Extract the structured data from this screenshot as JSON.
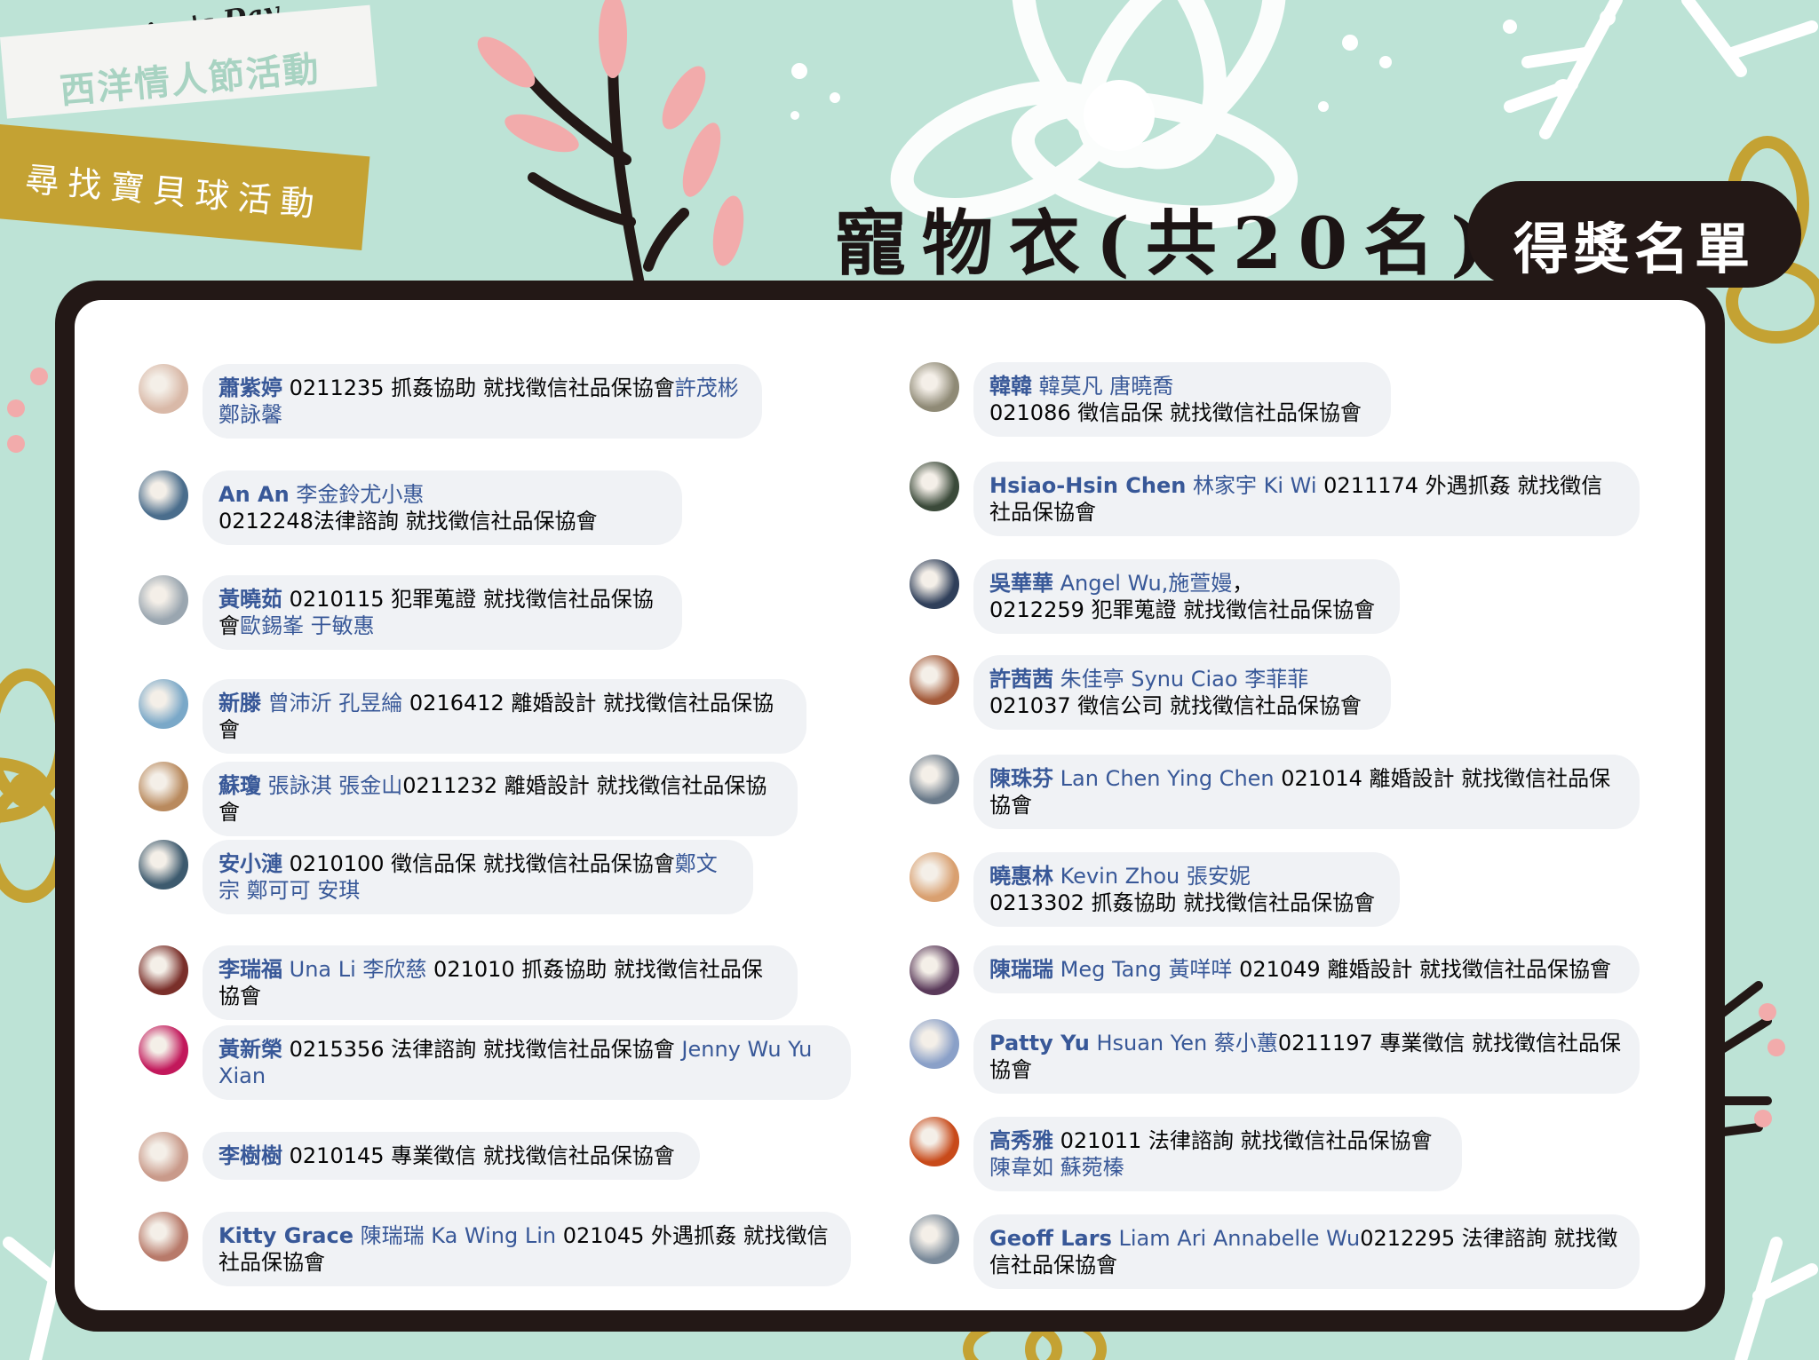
{
  "header": {
    "event_script": "Valentine's Day",
    "event_name": "西洋情人節活動",
    "activity": "尋找寶貝球活動",
    "prize_title": "寵物衣(共20名)",
    "badge": "得獎名單"
  },
  "colors": {
    "background": "#bde3d6",
    "frame": "#231816",
    "gold": "#c4a233",
    "pink": "#f2abab",
    "name_link": "#385898",
    "bubble": "#f0f2f5"
  },
  "left_column": [
    {
      "n1": "蕭紫婷",
      "t1": " 0211235 抓姦協助 就找徵信社品保協會",
      "n2": "許茂彬 鄭詠馨",
      "t2": "",
      "n3": "",
      "t3": "",
      "avatar": "#d9b9a8"
    },
    {
      "n1": "An An",
      "t1": " ",
      "n2": "李金鈴尤小惠",
      "t2": "",
      "n3": "",
      "t3": "0212248法律諮詢 就找徵信社品保協會",
      "avatar": "#4a6d8c"
    },
    {
      "n1": "黃曉茹",
      "t1": " 0210115 犯罪蒐證 就找徵信社品保協會",
      "n2": "歐錫峯 于敏惠",
      "t2": "",
      "n3": "",
      "t3": "",
      "avatar": "#9aa6b0"
    },
    {
      "n1": "新滕",
      "t1": " ",
      "n2": "曾沛沂 孔昱綸",
      "t2": " 0216412 離婚設計 就找徵信社品保協會",
      "n3": "",
      "t3": "",
      "avatar": "#7aa8c8"
    },
    {
      "n1": "蘇瓊",
      "t1": " ",
      "n2": "張詠淇 張金山",
      "t2": "0211232 離婚設計 就找徵信社品保協會",
      "n3": "",
      "t3": "",
      "avatar": "#b98a5e"
    },
    {
      "n1": "安小漣",
      "t1": " 0210100 徵信品保 就找徵信社品保協會",
      "n2": "鄭文宗 鄭可可 安琪",
      "t2": "",
      "n3": "",
      "t3": "",
      "avatar": "#3d5a6e"
    },
    {
      "n1": "李瑞福",
      "t1": " ",
      "n2": "Una Li 李欣慈",
      "t2": " 021010 抓姦協助 就找徵信社品保協會",
      "n3": "",
      "t3": "",
      "avatar": "#7a2f2a"
    },
    {
      "n1": "黃新榮",
      "t1": " 0215356 法律諮詢 就找徵信社品保協會 ",
      "n2": "Jenny Wu Yu Xian",
      "t2": "",
      "n3": "",
      "t3": "",
      "avatar": "#c2185b"
    },
    {
      "n1": "李樹樹",
      "t1": " 0210145 專業徵信 就找徵信社品保協會",
      "n2": "",
      "t2": "",
      "n3": "",
      "t3": "",
      "avatar": "#c99a8a"
    },
    {
      "n1": "Kitty Grace",
      "t1": " ",
      "n2": "陳瑞瑞 Ka Wing Lin",
      "t2": " 021045 外遇抓姦 就找徵信社品保協會",
      "n3": "",
      "t3": "",
      "avatar": "#b87a6a"
    }
  ],
  "right_column": [
    {
      "n1": "韓韓",
      "t1": " ",
      "n2": "韓莫凡 唐曉喬",
      "t2": "",
      "n3": "",
      "t3": "021086 徵信品保 就找徵信社品保協會",
      "avatar": "#8f8a76"
    },
    {
      "n1": "Hsiao-Hsin Chen",
      "t1": " ",
      "n2": "林家宇 Ki Wi",
      "t2": " 0211174 外遇抓姦 就找徵信社品保協會",
      "n3": "",
      "t3": "",
      "avatar": "#3b4a3a"
    },
    {
      "n1": "吳華華",
      "t1": " ",
      "n2": "Angel Wu,施萱嫚",
      "t2": "，",
      "n3": "",
      "t3": "0212259 犯罪蒐證 就找徵信社品保協會",
      "avatar": "#2f3f5a"
    },
    {
      "n1": "許茜茜",
      "t1": " ",
      "n2": "朱佳亭 Synu Ciao 李菲菲",
      "t2": "",
      "n3": "",
      "t3": "021037 徵信公司 就找徵信社品保協會",
      "avatar": "#a35a3a"
    },
    {
      "n1": "陳珠芬",
      "t1": " ",
      "n2": "Lan Chen Ying Chen",
      "t2": " 021014 離婚設計 就找徵信社品保協會",
      "n3": "",
      "t3": "",
      "avatar": "#6a7a8a"
    },
    {
      "n1": "曉惠林",
      "t1": " ",
      "n2": "Kevin Zhou 張安妮",
      "t2": "",
      "n3": "",
      "t3": "0213302 抓姦協助 就找徵信社品保協會",
      "avatar": "#d9a070"
    },
    {
      "n1": "陳瑞瑞",
      "t1": " ",
      "n2": "Meg Tang 黃咩咩",
      "t2": " 021049 離婚設計 就找徵信社品保協會",
      "n3": "",
      "t3": "",
      "avatar": "#5a3a5a"
    },
    {
      "n1": "Patty Yu",
      "t1": " ",
      "n2": "Hsuan Yen 蔡小蕙",
      "t2": "0211197 專業徵信 就找徵信社品保協會",
      "n3": "",
      "t3": "",
      "avatar": "#8aa0c8"
    },
    {
      "n1": "高秀雅",
      "t1": " 021011 法律諮詢 就找徵信社品保協會",
      "n2": "陳韋如 蘇菀榛",
      "t2": "",
      "n3": "",
      "t3": "",
      "avatar": "#c84a1a"
    },
    {
      "n1": "Geoff Lars",
      "t1": " ",
      "n2": "Liam Ari Annabelle Wu",
      "t2": "0212295 法律諮詢 就找徵信社品保協會",
      "n3": "",
      "t3": "",
      "avatar": "#7a8a9a"
    }
  ]
}
